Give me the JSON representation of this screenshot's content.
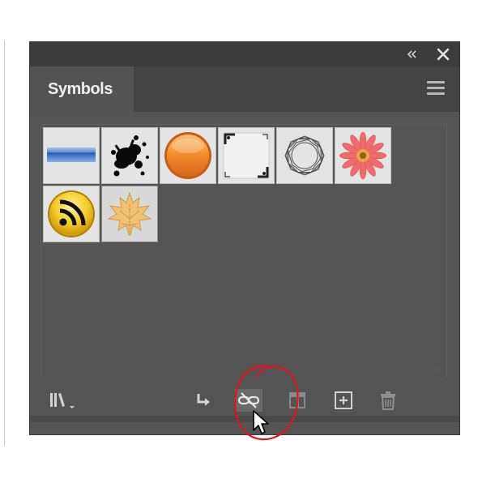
{
  "panel": {
    "tab_label": "Symbols"
  },
  "icons": {
    "collapse": "double-chevron-left-icon",
    "close": "close-icon",
    "menu": "hamburger-menu-icon"
  },
  "symbols": [
    {
      "name": "blue-banner"
    },
    {
      "name": "ink-splatter"
    },
    {
      "name": "orange-button"
    },
    {
      "name": "corner-frame"
    },
    {
      "name": "knot-ring"
    },
    {
      "name": "pink-daisy"
    },
    {
      "name": "rss-feed"
    },
    {
      "name": "maple-leaf"
    }
  ],
  "toolbar": [
    "symbol-libraries-menu-icon",
    "place-symbol-instance-icon",
    "break-link-to-symbol-icon",
    "symbol-options-icon",
    "new-symbol-icon",
    "delete-symbol-icon"
  ],
  "colors": {
    "panel_bg": "#545454",
    "titlebar_bg": "#3c3c3c",
    "annotation": "#e0141e"
  }
}
